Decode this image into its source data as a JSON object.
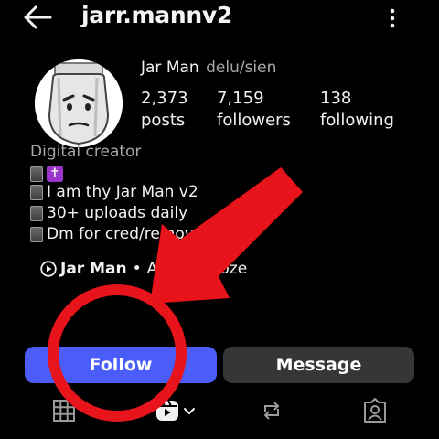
{
  "header": {
    "username": "jarr.mannv2",
    "back_icon": "arrow-left-icon",
    "menu_icon": "more-vertical-icon"
  },
  "profile": {
    "name": "Jar Man",
    "pronouns": "delu/sien",
    "stats": [
      {
        "value": "2,373",
        "label": "posts"
      },
      {
        "value": "7,159",
        "label": "followers"
      },
      {
        "value": "138",
        "label": "following"
      }
    ],
    "category": "Digital creator",
    "bio_lines": [
      "",
      "I am thy Jar Man v2",
      "30+ uploads daily",
      "Dm for cred/removal"
    ],
    "bio_cross_glyph": "✝",
    "audio": {
      "artist": "Jar Man",
      "separator": "•",
      "track": "Around Ooze"
    }
  },
  "actions": {
    "follow_label": "Follow",
    "message_label": "Message",
    "follow_color": "#4a5df9",
    "message_color": "#363636"
  },
  "tabs": [
    "grid-icon",
    "reels-icon",
    "reposts-icon",
    "tagged-icon"
  ],
  "annotation": {
    "color": "#e8141b",
    "shapes": [
      "arrow",
      "circle"
    ]
  }
}
